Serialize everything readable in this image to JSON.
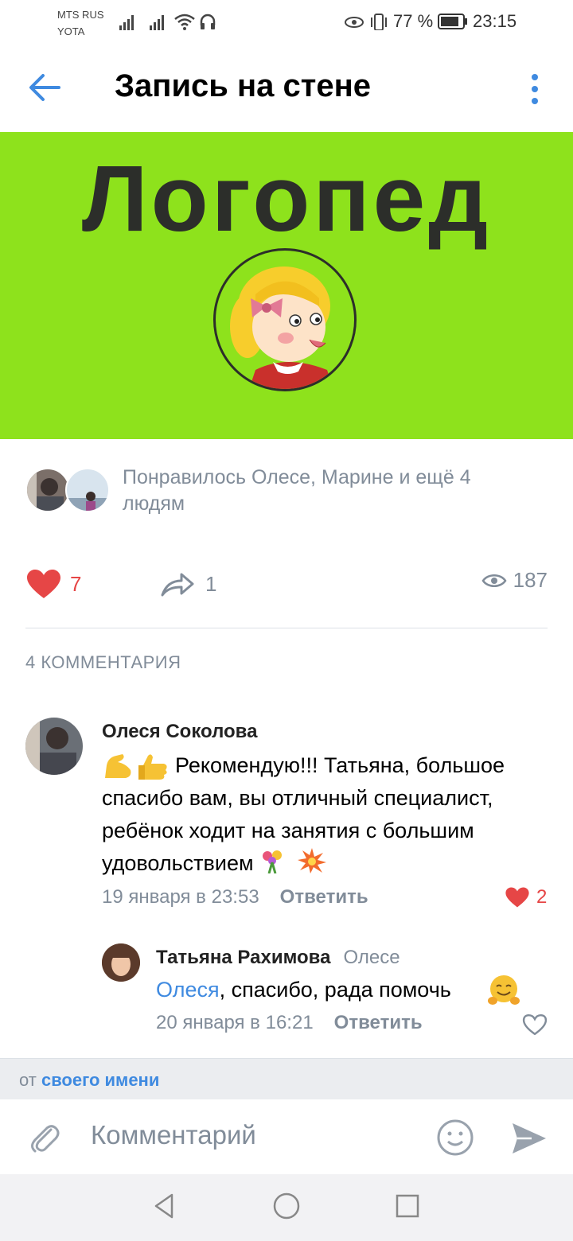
{
  "status_bar": {
    "carrier1": "MTS RUS",
    "carrier2": "YOTA",
    "battery": "77 %",
    "time": "23:15"
  },
  "header": {
    "title": "Запись на стене"
  },
  "post": {
    "banner_text": "Логопед",
    "likes_summary": "Понравилось Олесе, Марине и ещё 4 людям",
    "like_count": "7",
    "share_count": "1",
    "view_count": "187"
  },
  "comments_header": "4 КОММЕНТАРИЯ",
  "comments": [
    {
      "author": "Олеся Соколова",
      "text": "Рекомендую!!! Татьяна, большое спасибо вам, вы отличный специалист, ребёнок ходит на занятия с большим удовольствием",
      "date": "19 января в 23:53",
      "reply_label": "Ответить",
      "likes": "2"
    },
    {
      "author": "Татьяна Рахимова",
      "reply_to": "Олесе",
      "mention": "Олеся",
      "text": ", спасибо, рада помочь",
      "date": "20 января в 16:21",
      "reply_label": "Ответить"
    }
  ],
  "composer": {
    "from_prefix": "от",
    "from_value": "своего имени",
    "placeholder": "Комментарий"
  },
  "colors": {
    "accent": "#3f8ae0",
    "like_red": "#e64646",
    "banner_green": "#8ee21c",
    "muted": "#818c99"
  },
  "icons": [
    "back-arrow-icon",
    "more-vertical-icon",
    "heart-icon",
    "share-icon",
    "eye-icon",
    "paperclip-icon",
    "smile-icon",
    "send-icon"
  ]
}
